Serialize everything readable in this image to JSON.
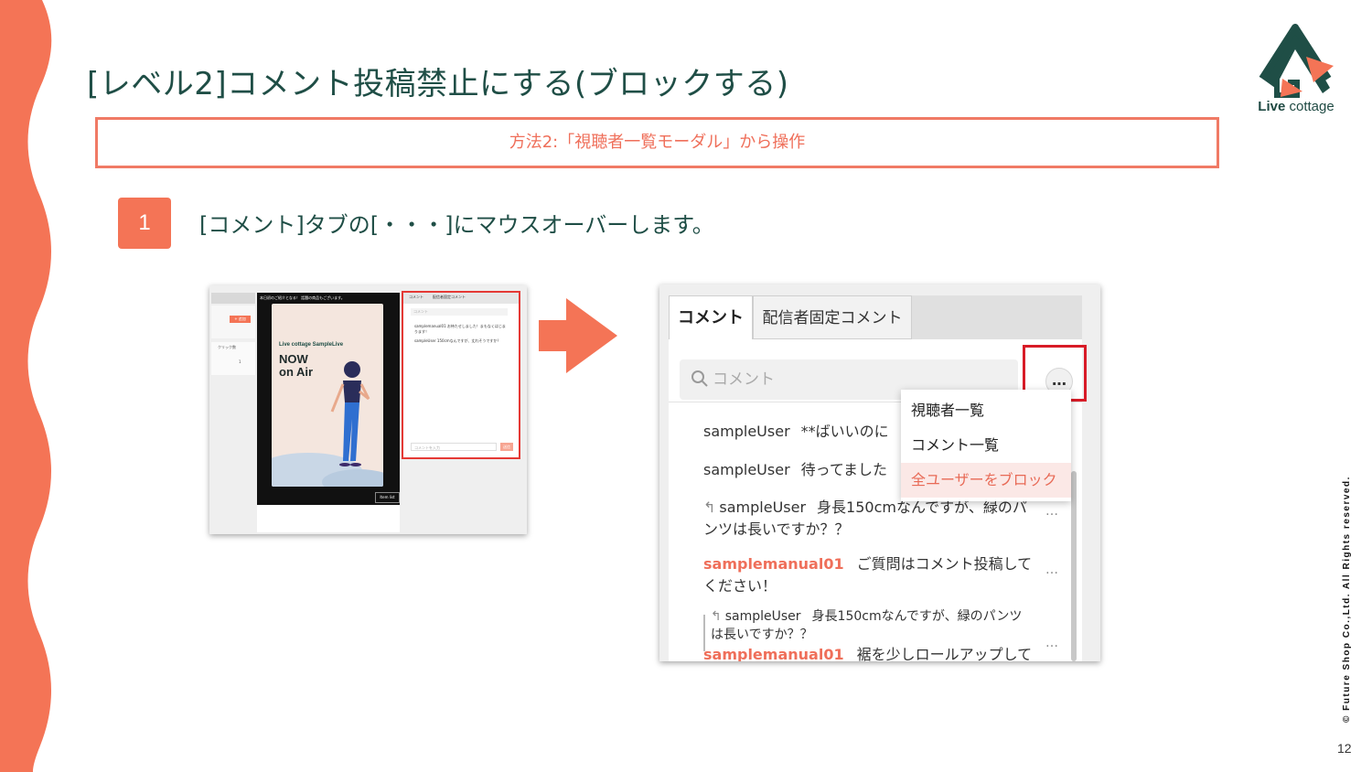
{
  "slide": {
    "title": "[レベル2]コメント投稿禁止にする(ブロックする)",
    "method_label": "方法2:「視聴者一覧モーダル」から操作",
    "step_number": "1",
    "step_text": "[コメント]タブの[・・・]にマウスオーバーします。",
    "page_number": "12",
    "copyright": "© Future Shop Co.,Ltd. All Rights reserved.",
    "accent_color": "#f47456",
    "title_color": "#1f4e46"
  },
  "logo": {
    "brand_bold": "Live",
    "brand_rest": " cottage"
  },
  "thumbnail": {
    "add_button": "+ 追加",
    "click_label": "クリック数",
    "click_count": "1",
    "player_caption": "本日初のご紹介となる！ 話題の商品もございます。",
    "card_subtitle": "Live cottage SampleLive",
    "card_big_1": "NOW",
    "card_big_2": "on Air",
    "item_button": "Item list",
    "chat_tab_1": "コメント",
    "chat_tab_2": "配信者固定コメント",
    "chat_search": "コメント",
    "chat_msg_1": "samplemanual01  お待たせしました！まもなくはじまります！",
    "chat_msg_2": "sampleUser  150cmなんですが、丈れそうですか？",
    "chat_input": "コメントを入力",
    "chat_send": "送信"
  },
  "panel": {
    "tab_active": "コメント",
    "tab_other": "配信者固定コメント",
    "search_placeholder": "コメント",
    "more_button": "…",
    "menu": {
      "item_1": "視聴者一覧",
      "item_2": "コメント一覧",
      "item_3": "全ユーザーをブロック"
    },
    "comments": [
      {
        "user": "sampleUser",
        "text": "**ばいいのに"
      },
      {
        "user": "sampleUser",
        "text": "待ってました"
      },
      {
        "user": "sampleUser",
        "text": "身長150cmなんですが、緑のパ",
        "text_cont": "ンツは長いですか？？"
      },
      {
        "user": "samplemanual01",
        "text": "ご質問はコメント投稿して",
        "text_cont": "ください！"
      },
      {
        "user": "sampleUser",
        "text": "身長150cmなんですが、緑のパンツ",
        "text_cont": "は長いですか？？"
      },
      {
        "user": "samplemanual01",
        "text": "裾を少しロールアップして"
      }
    ],
    "dots": "…"
  }
}
